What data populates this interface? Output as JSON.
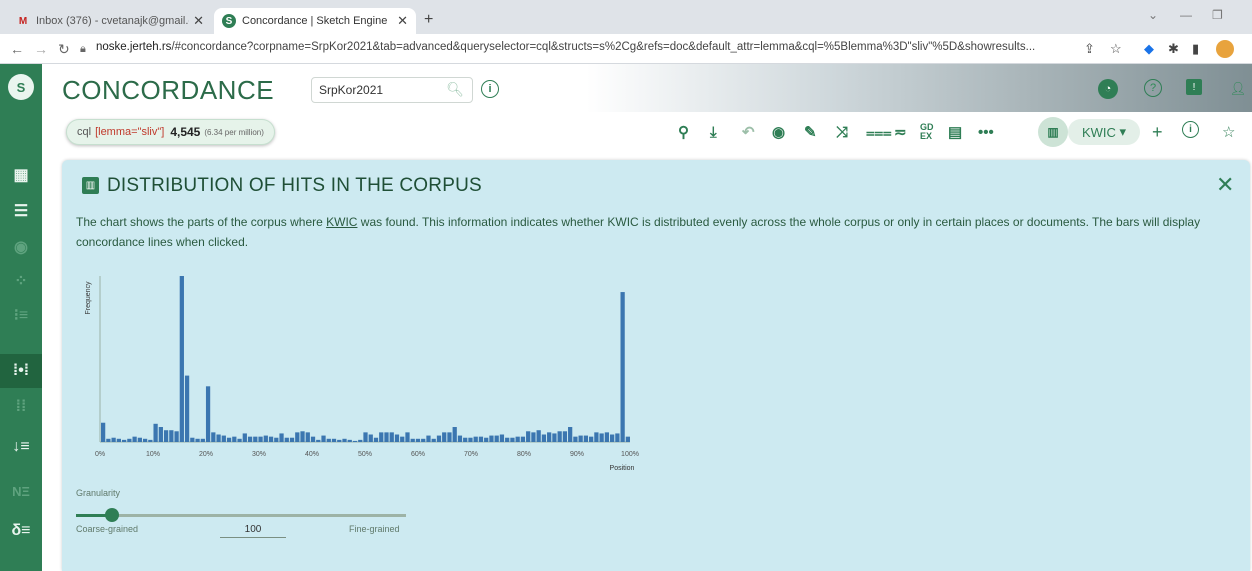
{
  "browser": {
    "tabs": [
      {
        "label": "Inbox (376) - cvetanajk@gmail.c",
        "favicon": "M",
        "favicon_color": "#c5221f",
        "active": false
      },
      {
        "label": "Concordance | Sketch Engine",
        "favicon": "S",
        "favicon_color": "#2f7e55",
        "active": true
      }
    ],
    "url_host": "noske.jerteh.rs",
    "url_rest": "/#concordance?corpname=SrpKor2021&tab=advanced&queryselector=cql&structs=s%2Cg&refs=doc&default_attr=lemma&cql=%5Blemma%3D\"sliv\"%5D&showresults..."
  },
  "app": {
    "title": "CONCORDANCE",
    "corpus": "SrpKor2021",
    "query": {
      "label": "cql",
      "value": "[lemma=\"sliv\"]",
      "hits": "4,545",
      "per_million": "(6.34 per million)"
    },
    "view_label": "KWIC",
    "toolbar_icons": [
      "search-icon",
      "download-icon",
      "undo-icon",
      "eye-icon",
      "tag-icon",
      "shuffle-icon",
      "sort-icon",
      "filter-icon",
      "gdex-icon",
      "note-icon",
      "more-icon",
      "chart-icon"
    ],
    "accent": "#2f7e55"
  },
  "panel": {
    "title": "DISTRIBUTION OF HITS IN THE CORPUS",
    "desc_before": "The chart shows the parts of the corpus where ",
    "desc_link": "KWIC",
    "desc_after": " was found. This information indicates whether KWIC is distributed evenly across the whole corpus or only in certain places or documents. The bars will display concordance lines when clicked.",
    "granularity_label": "Granularity",
    "coarse_label": "Coarse-grained",
    "fine_label": "Fine-grained",
    "granularity_value": "100",
    "granularity_fraction": 0.11
  },
  "chart_data": {
    "type": "bar",
    "ylabel": "Frequency",
    "xlabel": "Position",
    "xticks": [
      "0%",
      "10%",
      "20%",
      "30%",
      "40%",
      "50%",
      "60%",
      "70%",
      "80%",
      "90%",
      "100%"
    ],
    "ylim": [
      0,
      155
    ],
    "bar_color": "#3b76b0",
    "values": [
      18,
      3,
      4,
      3,
      2,
      3,
      5,
      4,
      3,
      2,
      17,
      14,
      11,
      11,
      10,
      155,
      62,
      4,
      3,
      3,
      52,
      9,
      7,
      6,
      4,
      5,
      3,
      8,
      5,
      5,
      5,
      6,
      5,
      4,
      8,
      4,
      4,
      9,
      10,
      9,
      5,
      2,
      6,
      3,
      3,
      2,
      3,
      2,
      1,
      2,
      9,
      7,
      4,
      9,
      9,
      9,
      7,
      5,
      9,
      3,
      3,
      3,
      6,
      3,
      6,
      9,
      9,
      14,
      6,
      4,
      4,
      5,
      5,
      4,
      6,
      6,
      7,
      4,
      4,
      5,
      5,
      10,
      9,
      11,
      7,
      9,
      8,
      10,
      10,
      14,
      5,
      6,
      6,
      5,
      9,
      8,
      9,
      7,
      8,
      140,
      5
    ]
  }
}
